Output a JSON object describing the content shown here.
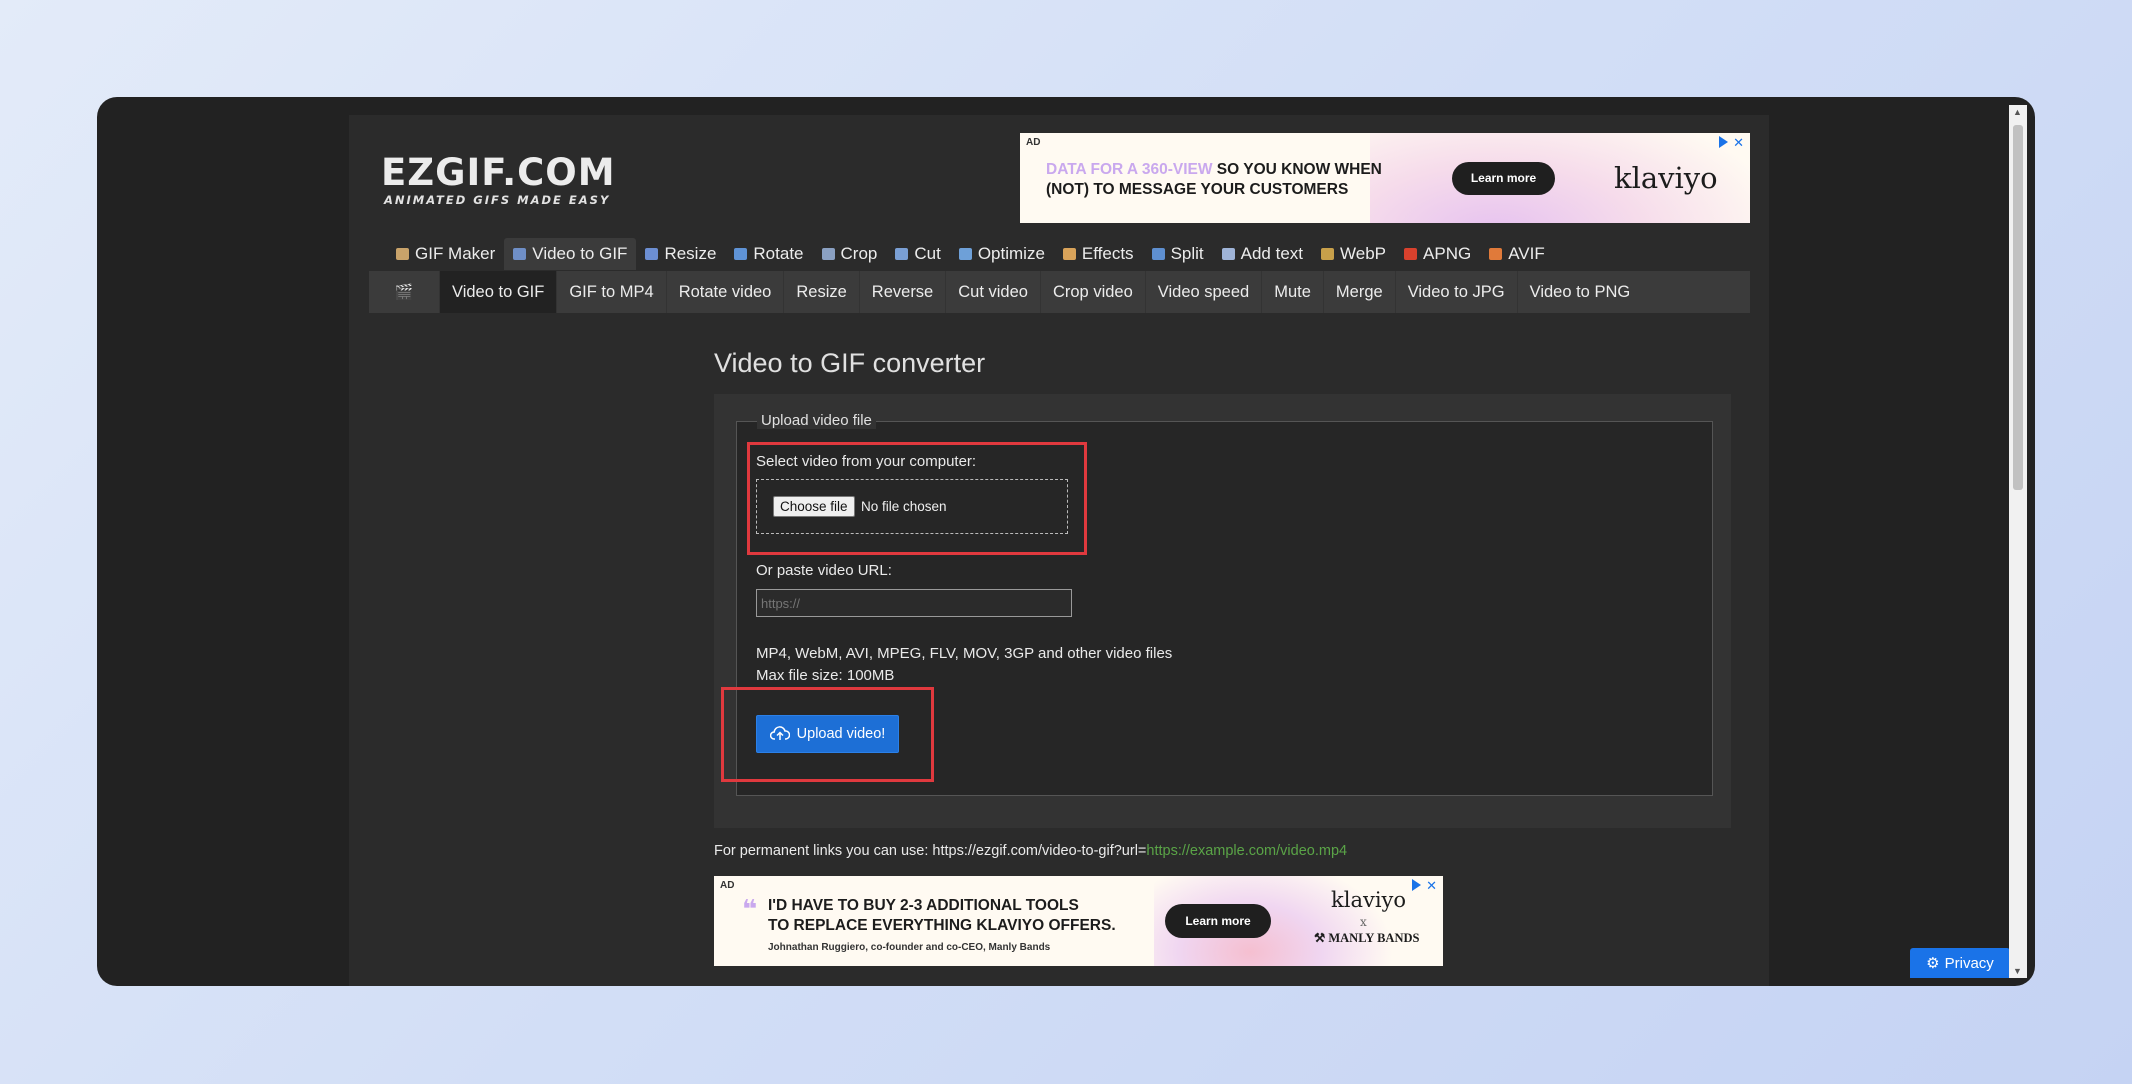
{
  "logo": {
    "main": "EZGIF.COM",
    "tagline": "ANIMATED GIFS MADE EASY"
  },
  "ad_top": {
    "label": "AD",
    "text_highlight": "DATA FOR A 360-VIEW",
    "text_rest": " SO YOU KNOW WHEN",
    "text_line2": "(NOT) TO MESSAGE YOUR CUSTOMERS",
    "cta": "Learn more",
    "brand": "klaviyo",
    "close": "✕"
  },
  "nav": [
    {
      "label": "GIF Maker",
      "icon_color": "#c9a36a"
    },
    {
      "label": "Video to GIF",
      "icon_color": "#6f8fc7",
      "active": true
    },
    {
      "label": "Resize",
      "icon_color": "#6c8ed2"
    },
    {
      "label": "Rotate",
      "icon_color": "#5f93d6"
    },
    {
      "label": "Crop",
      "icon_color": "#8aa0c2"
    },
    {
      "label": "Cut",
      "icon_color": "#7a9fd4"
    },
    {
      "label": "Optimize",
      "icon_color": "#6ea0d8"
    },
    {
      "label": "Effects",
      "icon_color": "#d9a35a"
    },
    {
      "label": "Split",
      "icon_color": "#5e8fd0"
    },
    {
      "label": "Add text",
      "icon_color": "#9fb4d8"
    },
    {
      "label": "WebP",
      "icon_color": "#c8a04a"
    },
    {
      "label": "APNG",
      "icon_color": "#d9412d"
    },
    {
      "label": "AVIF",
      "icon_color": "#e07a3a"
    }
  ],
  "subnav": [
    {
      "label": "Video to GIF",
      "active": true
    },
    {
      "label": "GIF to MP4"
    },
    {
      "label": "Rotate video"
    },
    {
      "label": "Resize"
    },
    {
      "label": "Reverse"
    },
    {
      "label": "Cut video"
    },
    {
      "label": "Crop video"
    },
    {
      "label": "Video speed"
    },
    {
      "label": "Mute"
    },
    {
      "label": "Merge"
    },
    {
      "label": "Video to JPG"
    },
    {
      "label": "Video to PNG"
    }
  ],
  "main": {
    "title": "Video to GIF converter",
    "legend": "Upload video file",
    "select_label": "Select video from your computer:",
    "choose_file": "Choose file",
    "no_file": "No file chosen",
    "url_label": "Or paste video URL:",
    "url_placeholder": "https://",
    "formats": "MP4, WebM, AVI, MPEG, FLV, MOV, 3GP and other video files",
    "max_size": "Max file size: 100MB",
    "upload_button": "Upload video!"
  },
  "perma": {
    "prefix": "For permanent links you can use: https://ezgif.com/video-to-gif?url=",
    "example": "https://example.com/video.mp4"
  },
  "ad_bottom": {
    "label": "AD",
    "quote_line1": "I'D HAVE TO BUY 2-3 ADDITIONAL TOOLS",
    "quote_line2": "TO REPLACE EVERYTHING KLAVIYO OFFERS.",
    "byline": "Johnathan Ruggiero, co-founder and co-CEO, Manly Bands",
    "cta": "Learn more",
    "brand": "klaviyo",
    "times": "x",
    "partner": "MANLY BANDS",
    "close": "✕"
  },
  "privacy": "Privacy"
}
